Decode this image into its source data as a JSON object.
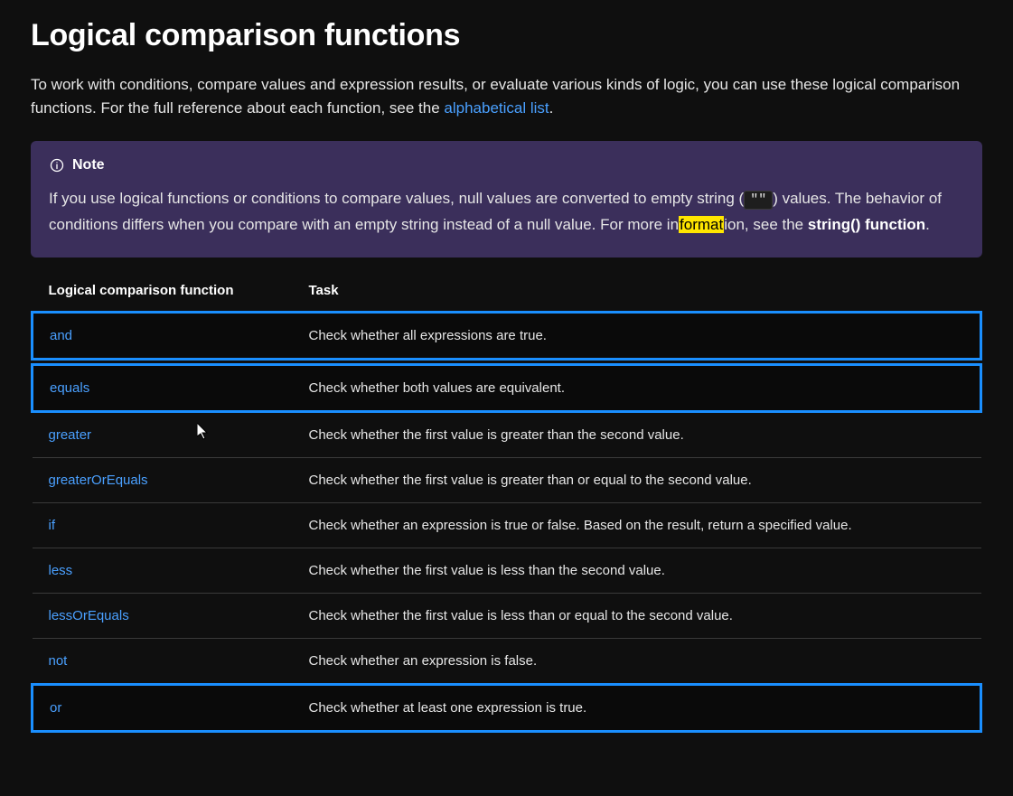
{
  "title": "Logical comparison functions",
  "intro_text_1": "To work with conditions, compare values and expression results, or evaluate various kinds of logic, you can use these logical comparison functions. For the full reference about each function, see the ",
  "intro_link": "alphabetical list",
  "intro_text_2": ".",
  "note": {
    "label": "Note",
    "body_1": "If you use logical functions or conditions to compare values, null values are converted to empty string (",
    "code": "\"\"",
    "body_2": ") values. The behavior of conditions differs when you compare with an empty string instead of a null value. For more in",
    "highlight": "format",
    "body_3": "ion, see the ",
    "bold": "string() function",
    "body_4": "."
  },
  "table": {
    "header_func": "Logical comparison function",
    "header_task": "Task",
    "rows": [
      {
        "func": "and",
        "task": "Check whether all expressions are true.",
        "hl": true
      },
      {
        "func": "equals",
        "task": "Check whether both values are equivalent.",
        "hl": true
      },
      {
        "func": "greater",
        "task": "Check whether the first value is greater than the second value.",
        "hl": false
      },
      {
        "func": "greaterOrEquals",
        "task": "Check whether the first value is greater than or equal to the second value.",
        "hl": false
      },
      {
        "func": "if",
        "task": "Check whether an expression is true or false. Based on the result, return a specified value.",
        "hl": false
      },
      {
        "func": "less",
        "task": "Check whether the first value is less than the second value.",
        "hl": false
      },
      {
        "func": "lessOrEquals",
        "task": "Check whether the first value is less than or equal to the second value.",
        "hl": false
      },
      {
        "func": "not",
        "task": "Check whether an expression is false.",
        "hl": false
      },
      {
        "func": "or",
        "task": "Check whether at least one expression is true.",
        "hl": true
      }
    ]
  }
}
